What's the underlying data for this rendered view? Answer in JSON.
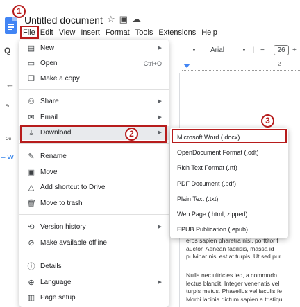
{
  "header": {
    "doc_title": "Untitled document",
    "title_icons": [
      "star-icon",
      "folder-move-icon",
      "cloud-status-icon"
    ]
  },
  "menubar": [
    "File",
    "Edit",
    "View",
    "Insert",
    "Format",
    "Tools",
    "Extensions",
    "Help"
  ],
  "left_panel": {
    "search_glyph": "Q",
    "back_glyph": "←",
    "summary_label": "Su",
    "outline_label": "Ou",
    "item_label": "– W"
  },
  "toolbar": {
    "font_name": "Arial",
    "font_size": "26",
    "minus": "−",
    "plus": "+",
    "ruler_number": "2"
  },
  "file_menu": {
    "items": [
      {
        "label": "New",
        "icon": "document-icon",
        "arrow": true
      },
      {
        "label": "Open",
        "icon": "folder-icon",
        "shortcut": "Ctrl+O"
      },
      {
        "label": "Make a copy",
        "icon": "copy-icon"
      },
      {
        "label": "Share",
        "icon": "person-add-icon",
        "arrow": true
      },
      {
        "label": "Email",
        "icon": "email-icon",
        "arrow": true
      },
      {
        "label": "Download",
        "icon": "download-icon",
        "arrow": true,
        "highlighted": true
      },
      {
        "label": "Rename",
        "icon": "pencil-icon"
      },
      {
        "label": "Move",
        "icon": "folder-move-icon"
      },
      {
        "label": "Add shortcut to Drive",
        "icon": "drive-shortcut-icon"
      },
      {
        "label": "Move to trash",
        "icon": "trash-icon"
      },
      {
        "label": "Version history",
        "icon": "history-icon",
        "arrow": true
      },
      {
        "label": "Make available offline",
        "icon": "offline-icon"
      },
      {
        "label": "Details",
        "icon": "info-icon"
      },
      {
        "label": "Language",
        "icon": "globe-icon",
        "arrow": true
      },
      {
        "label": "Page setup",
        "icon": "page-setup-icon"
      }
    ]
  },
  "download_menu": {
    "items": [
      "Microsoft Word (.docx)",
      "OpenDocument Format (.odt)",
      "Rich Text Format (.rtf)",
      "PDF Document (.pdf)",
      "Plain Text (.txt)",
      "Web Page (.html, zipped)",
      "EPUB Publication (.epub)"
    ]
  },
  "doc_body": {
    "para1": [
      "eros sapien pharetra nisi, porttitor f",
      "auctor. Aenean facilisis, massa id",
      "pulvinar nisi est at turpis. Ut sed pur"
    ],
    "para2": [
      "Nulla nec ultricies leo, a commodo",
      "lectus blandit. Integer venenatis vel",
      "turpis metus. Phasellus vel iaculis fe",
      "Morbi lacinia dictum sapien a tristiqu"
    ]
  },
  "annotations": {
    "badges": [
      "1",
      "2",
      "3"
    ],
    "color": "#b71c1c"
  },
  "colors": {
    "accent": "#4285f4",
    "annotation": "#b71c1c"
  }
}
